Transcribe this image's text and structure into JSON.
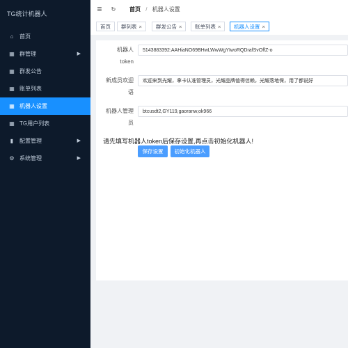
{
  "app": {
    "title": "TG统计机器人"
  },
  "sidebar": {
    "items": [
      {
        "label": "首页",
        "icon": "home-icon",
        "glyph": "⌂",
        "has_arrow": false,
        "active": false
      },
      {
        "label": "群管理",
        "icon": "grid-icon",
        "glyph": "▦",
        "has_arrow": true,
        "active": false
      },
      {
        "label": "群发公告",
        "icon": "grid-icon",
        "glyph": "▦",
        "has_arrow": false,
        "active": false
      },
      {
        "label": "账单列表",
        "icon": "grid-icon",
        "glyph": "▦",
        "has_arrow": false,
        "active": false
      },
      {
        "label": "机器人设置",
        "icon": "grid-icon",
        "glyph": "▦",
        "has_arrow": false,
        "active": true
      },
      {
        "label": "TG用户列表",
        "icon": "grid-icon",
        "glyph": "▦",
        "has_arrow": false,
        "active": false
      },
      {
        "label": "配置管理",
        "icon": "bar-chart-icon",
        "glyph": "▮",
        "has_arrow": true,
        "active": false
      },
      {
        "label": "系统管理",
        "icon": "gear-icon",
        "glyph": "⚙",
        "has_arrow": true,
        "active": false
      }
    ],
    "arrow_glyph": "▶"
  },
  "header": {
    "menu_icon": "☰",
    "refresh_icon": "↻",
    "breadcrumb": {
      "home": "首页",
      "separator": "/",
      "current": "机器人设置"
    }
  },
  "tabs": [
    {
      "label": "首页",
      "closable": false,
      "active": false
    },
    {
      "label": "群列表",
      "closable": true,
      "active": false
    },
    {
      "label": "群发公告",
      "closable": true,
      "active": false
    },
    {
      "label": "账单列表",
      "closable": true,
      "active": false
    },
    {
      "label": "机器人设置",
      "closable": true,
      "active": true
    }
  ],
  "tab_close_glyph": "×",
  "form": {
    "token_label_1": "机器人",
    "token_label_2": "token",
    "token_value": "5143883392:AAHiaNO69BHwLWwWgYIwoRQDrafSvOffZ-o",
    "welcome_label_1": "新成员欢迎",
    "welcome_label_2": "语",
    "welcome_value": "欢迎来到光耀，拿卡认准管理员，光耀品牌值得信赖，光耀落地保，用了都说好",
    "admin_label_1": "机器人管理",
    "admin_label_2": "员",
    "admin_value": "btcusdt2,GY119,gaoranw,ok966"
  },
  "notice": "请先填写机器人token后保存设置,再点击初始化机器人!",
  "buttons": {
    "save": "保存设置",
    "init": "初始化机器人"
  },
  "colors": {
    "sidebar_bg": "#0d1a2b",
    "active": "#1890ff",
    "button": "#4a9dff"
  }
}
